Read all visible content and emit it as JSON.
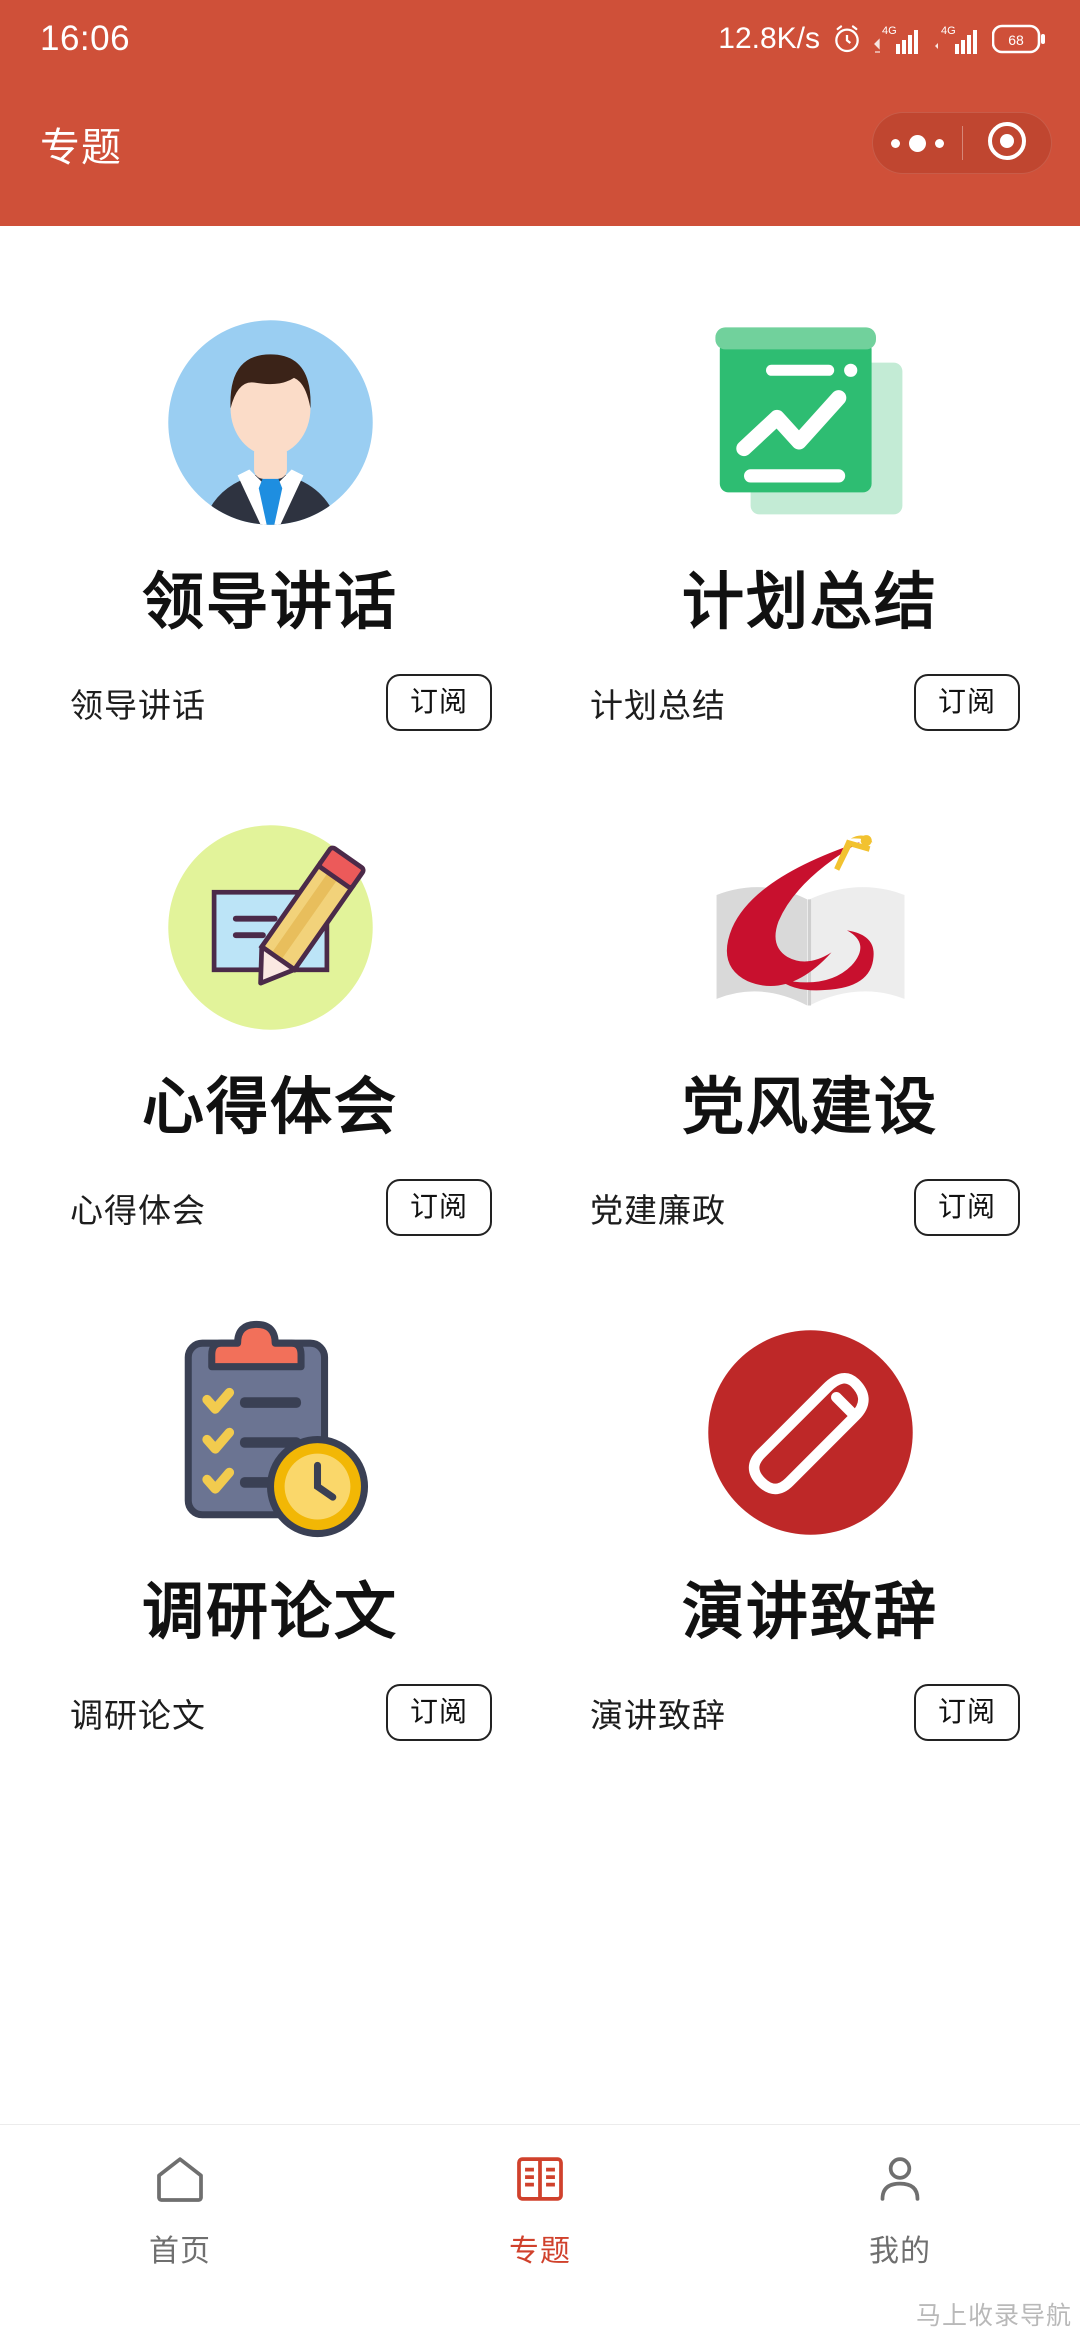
{
  "status_bar": {
    "time": "16:06",
    "network_speed": "12.8K/s",
    "alarm_icon": "alarm-clock-icon",
    "signal_1_label": "4G",
    "signal_2_label": "4G",
    "battery_level": "68"
  },
  "header": {
    "title": "专题",
    "background_color": "#CF5039",
    "capsule": {
      "more_icon": "more-dots-icon",
      "target_icon": "target-circle-icon"
    }
  },
  "categories": [
    {
      "title": "领导讲话",
      "sub_name": "领导讲话",
      "subscribe_label": "订阅",
      "icon": "leader-avatar-icon",
      "colors": {
        "circle": "#9ACEF2",
        "hair": "#3B2318",
        "skin": "#FBDCC8",
        "suit": "#2E3340",
        "tie": "#1E8EE0"
      }
    },
    {
      "title": "计划总结",
      "sub_name": "计划总结",
      "subscribe_label": "订阅",
      "icon": "chart-board-icon",
      "colors": {
        "board": "#2EBD72",
        "shadow": "#C3EBD5",
        "top_bar": "#71D19C",
        "line": "#FFFFFF"
      }
    },
    {
      "title": "心得体会",
      "sub_name": "心得体会",
      "subscribe_label": "订阅",
      "icon": "notepad-pencil-icon",
      "colors": {
        "circle": "#E2F39A",
        "card": "#BCE4F7",
        "pencil": "#F2D27A",
        "eraser": "#EC5A5A",
        "outline": "#4B2A49"
      }
    },
    {
      "title": "党风建设",
      "sub_name": "党建廉政",
      "subscribe_label": "订阅",
      "icon": "party-flag-book-icon",
      "colors": {
        "book": "#D8D8D8",
        "ribbon": "#C8102E",
        "emblem": "#F2C230"
      }
    },
    {
      "title": "调研论文",
      "sub_name": "调研论文",
      "subscribe_label": "订阅",
      "icon": "clipboard-clock-icon",
      "colors": {
        "clipboard": "#6B7492",
        "clip": "#F2705A",
        "check": "#F2CB4E",
        "clock": "#F2B705",
        "outline": "#3A4054"
      }
    },
    {
      "title": "演讲致辞",
      "sub_name": "演讲致辞",
      "subscribe_label": "订阅",
      "icon": "microphone-circle-icon",
      "colors": {
        "circle": "#BE2828",
        "mic": "#FFFFFF"
      }
    }
  ],
  "tabbar": {
    "items": [
      {
        "label": "首页",
        "icon": "home-icon",
        "active": false
      },
      {
        "label": "专题",
        "icon": "topic-book-icon",
        "active": true
      },
      {
        "label": "我的",
        "icon": "person-icon",
        "active": false
      }
    ],
    "active_color": "#D0412C",
    "inactive_color": "#6f6f6f"
  },
  "watermark": {
    "text": "马上收录导航"
  }
}
